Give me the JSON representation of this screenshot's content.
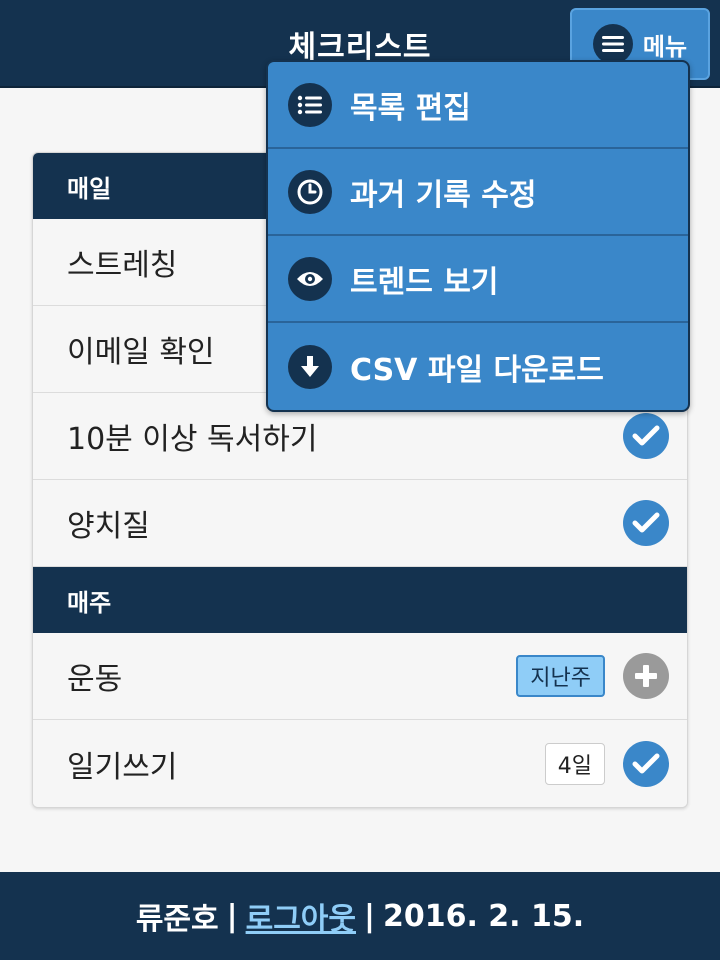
{
  "header": {
    "title": "체크리스트",
    "menu_label": "메뉴"
  },
  "dropdown": {
    "items": [
      {
        "label": "목록 편집",
        "icon": "list-icon"
      },
      {
        "label": "과거 기록 수정",
        "icon": "clock-icon"
      },
      {
        "label": "트렌드 보기",
        "icon": "eye-icon"
      },
      {
        "label": "CSV 파일 다운로드",
        "icon": "download-icon"
      }
    ]
  },
  "checklist": {
    "daily": {
      "title": "매일",
      "items": [
        {
          "label": "스트레칭",
          "status": "done"
        },
        {
          "label": "이메일 확인",
          "status": "done"
        },
        {
          "label": "10분 이상 독서하기",
          "status": "done"
        },
        {
          "label": "양치질",
          "status": "done"
        }
      ]
    },
    "weekly": {
      "title": "매주",
      "items": [
        {
          "label": "운동",
          "badge": "지난주",
          "status": "add"
        },
        {
          "label": "일기쓰기",
          "badge": "4일",
          "status": "done"
        }
      ]
    }
  },
  "footer": {
    "user": "류준호",
    "logout": "로그아웃",
    "separator": "|",
    "date": "2016. 2. 15."
  },
  "colors": {
    "navy": "#14324f",
    "blue": "#3a87c9",
    "light_blue": "#8fcdf7",
    "gray": "#9a9a9a"
  }
}
